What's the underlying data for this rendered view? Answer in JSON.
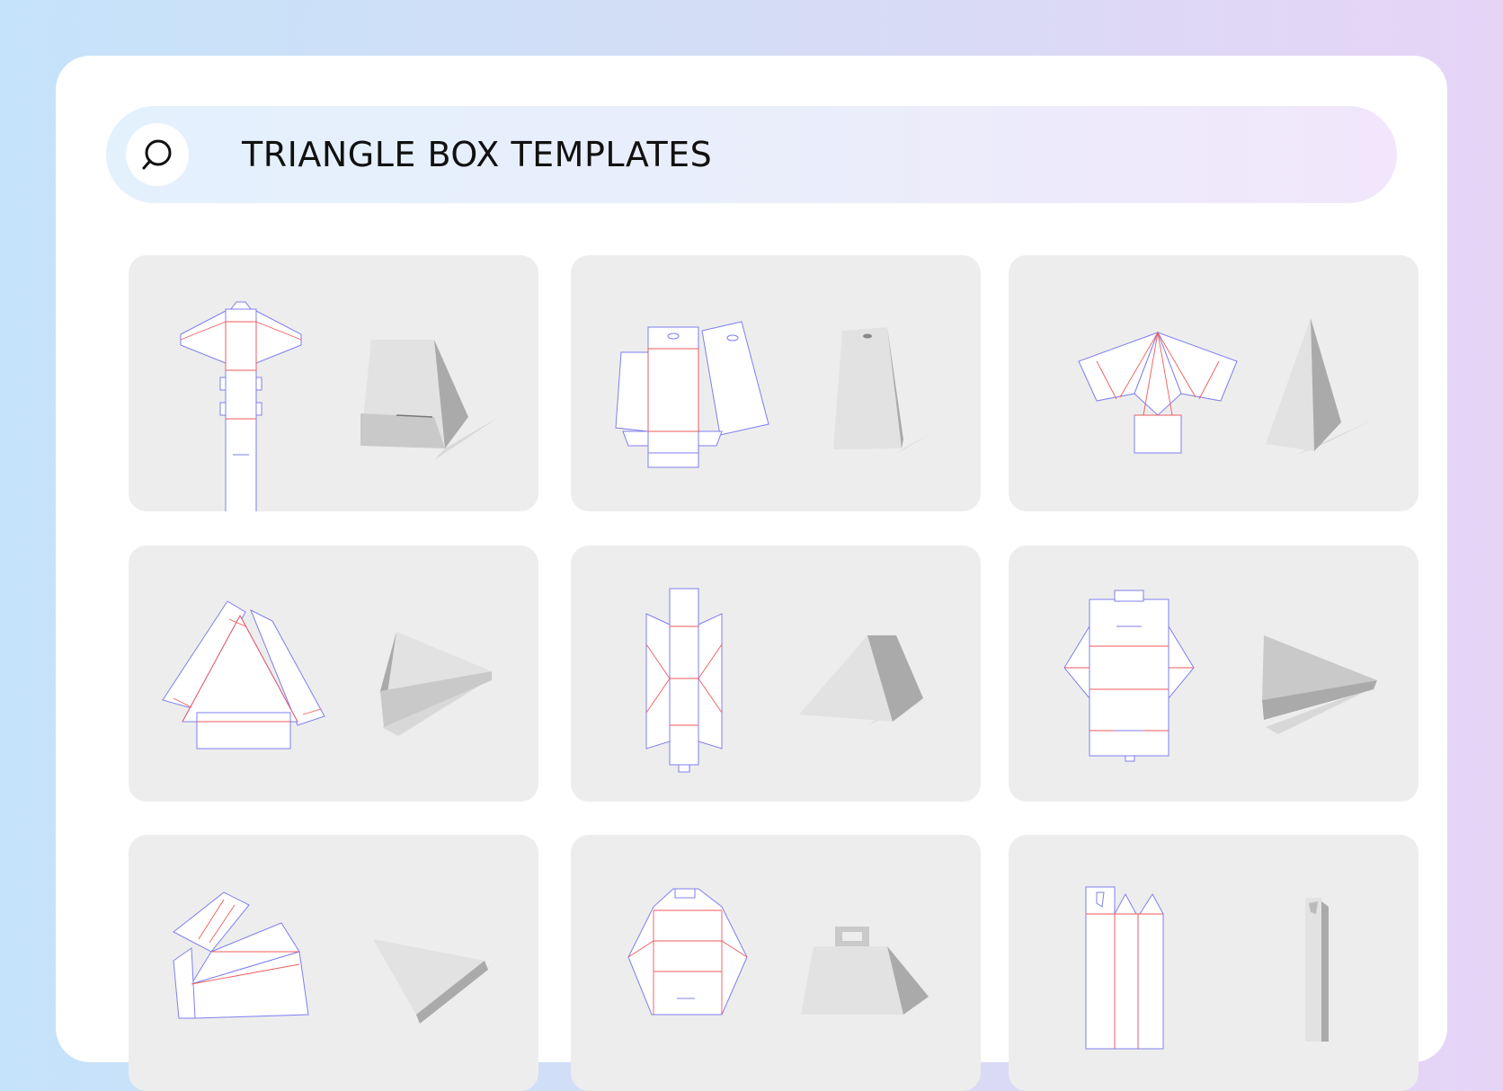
{
  "search": {
    "title": "TRIANGLE BOX TEMPLATES",
    "icon": "search-icon"
  },
  "templates": [
    {
      "id": 1,
      "row": 1,
      "col": 1
    },
    {
      "id": 2,
      "row": 1,
      "col": 2
    },
    {
      "id": 3,
      "row": 1,
      "col": 3
    },
    {
      "id": 4,
      "row": 2,
      "col": 1
    },
    {
      "id": 5,
      "row": 2,
      "col": 2
    },
    {
      "id": 6,
      "row": 2,
      "col": 3
    },
    {
      "id": 7,
      "row": 3,
      "col": 1
    },
    {
      "id": 8,
      "row": 3,
      "col": 2
    },
    {
      "id": 9,
      "row": 3,
      "col": 3
    }
  ],
  "colors": {
    "cut_line": "#7f7ff0",
    "fold_line": "#ef5a5a",
    "card_background": "#ededed"
  }
}
